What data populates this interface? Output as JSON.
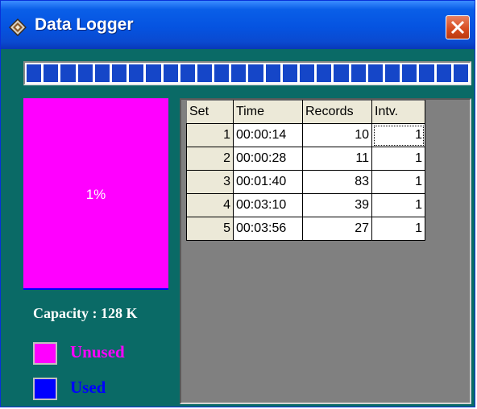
{
  "window": {
    "title": "Data Logger",
    "icon": "data-logger-app-icon",
    "close_icon": "close-icon"
  },
  "progress": {
    "blocks": 26,
    "color": "#1546c8"
  },
  "memory": {
    "used_percent_label": "1%",
    "used_fraction": 0.01,
    "capacity_label": "Capacity : 128 K",
    "legend": [
      {
        "label": "Unused",
        "color": "#ff00ff"
      },
      {
        "label": "Used",
        "color": "#0000ff"
      }
    ]
  },
  "table": {
    "columns": [
      "Set",
      "Time",
      "Records",
      "Intv."
    ],
    "rows": [
      {
        "set": "1",
        "time": "00:00:14",
        "records": "10",
        "intv": "1"
      },
      {
        "set": "2",
        "time": "00:00:28",
        "records": "11",
        "intv": "1"
      },
      {
        "set": "3",
        "time": "00:01:40",
        "records": "83",
        "intv": "1"
      },
      {
        "set": "4",
        "time": "00:03:10",
        "records": "39",
        "intv": "1"
      },
      {
        "set": "5",
        "time": "00:03:56",
        "records": "27",
        "intv": "1"
      }
    ]
  }
}
